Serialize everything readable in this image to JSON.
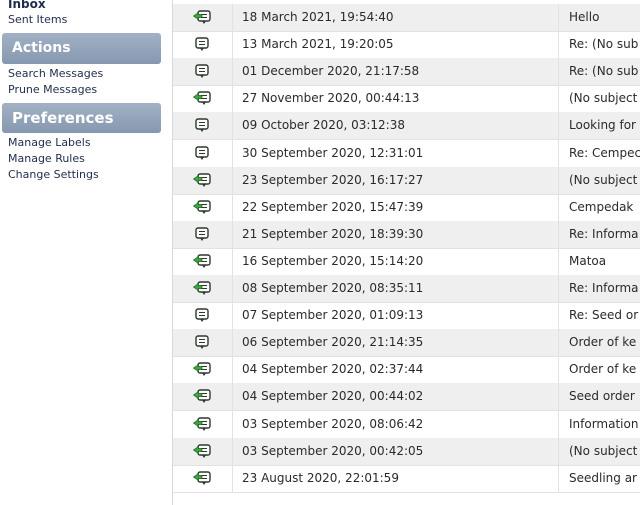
{
  "sidebar": {
    "inbox": "Inbox",
    "sent_items": "Sent Items",
    "actions_header": "Actions",
    "search_messages": "Search Messages",
    "prune_messages": "Prune Messages",
    "preferences_header": "Preferences",
    "manage_labels": "Manage Labels",
    "manage_rules": "Manage Rules",
    "change_settings": "Change Settings"
  },
  "messages": [
    {
      "icon": "replied-message-icon",
      "date": "18 March 2021, 19:54:40",
      "subject": "Hello"
    },
    {
      "icon": "read-message-icon",
      "date": "13 March 2021, 19:20:05",
      "subject": "Re: (No sub"
    },
    {
      "icon": "read-message-icon",
      "date": "01 December 2020, 21:17:58",
      "subject": "Re: (No sub"
    },
    {
      "icon": "replied-message-icon",
      "date": "27 November 2020, 00:44:13",
      "subject": "(No subject"
    },
    {
      "icon": "read-message-icon",
      "date": "09 October 2020, 03:12:38",
      "subject": "Looking for"
    },
    {
      "icon": "read-message-icon",
      "date": "30 September 2020, 12:31:01",
      "subject": "Re: Cempec"
    },
    {
      "icon": "replied-message-icon",
      "date": "23 September 2020, 16:17:27",
      "subject": "(No subject"
    },
    {
      "icon": "replied-message-icon",
      "date": "22 September 2020, 15:47:39",
      "subject": "Cempedak"
    },
    {
      "icon": "read-message-icon",
      "date": "21 September 2020, 18:39:30",
      "subject": "Re: Informa"
    },
    {
      "icon": "replied-message-icon",
      "date": "16 September 2020, 15:14:20",
      "subject": "Matoa"
    },
    {
      "icon": "replied-message-icon",
      "date": "08 September 2020, 08:35:11",
      "subject": "Re: Informa"
    },
    {
      "icon": "read-message-icon",
      "date": "07 September 2020, 01:09:13",
      "subject": "Re: Seed or"
    },
    {
      "icon": "read-message-icon",
      "date": "06 September 2020, 21:14:35",
      "subject": "Order of ke"
    },
    {
      "icon": "replied-message-icon",
      "date": "04 September 2020, 02:37:44",
      "subject": "Order of ke"
    },
    {
      "icon": "replied-message-icon",
      "date": "04 September 2020, 00:44:02",
      "subject": "Seed order"
    },
    {
      "icon": "replied-message-icon",
      "date": "03 September 2020, 08:06:42",
      "subject": "Information"
    },
    {
      "icon": "replied-message-icon",
      "date": "03 September 2020, 00:42:05",
      "subject": "(No subject"
    },
    {
      "icon": "replied-message-icon",
      "date": "23 August 2020, 22:01:59",
      "subject": "Seedling ar"
    }
  ]
}
